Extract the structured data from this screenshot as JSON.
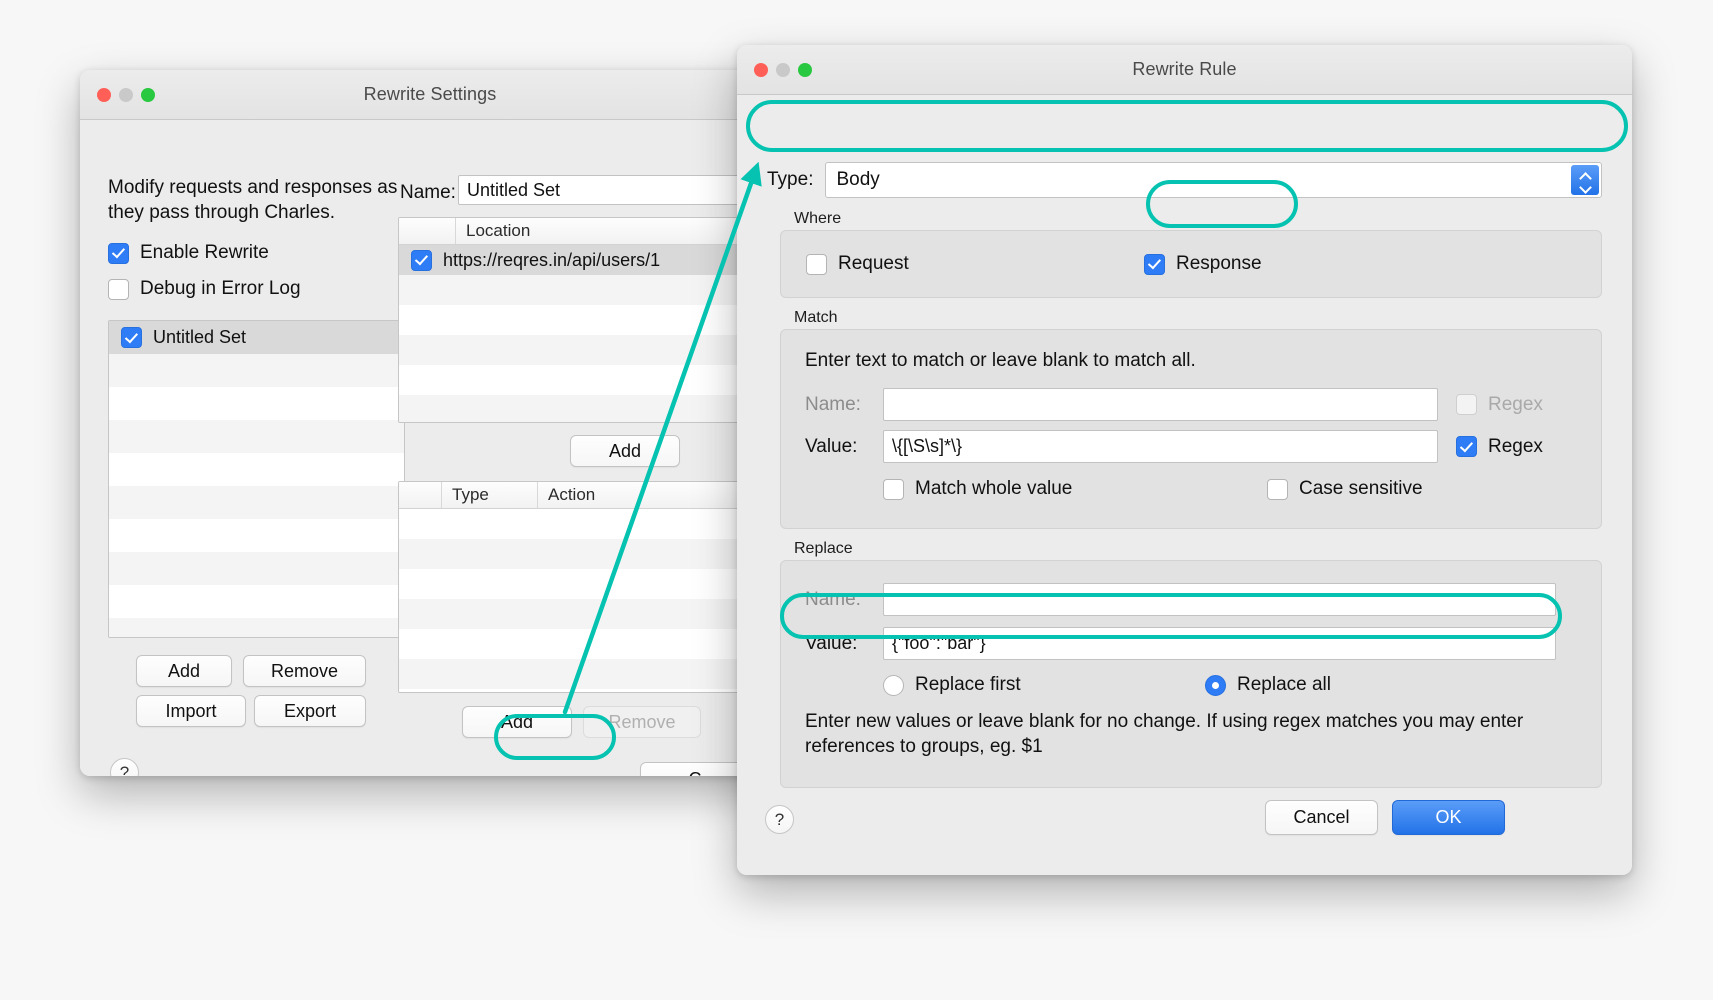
{
  "settings_window": {
    "title": "Rewrite Settings",
    "traffic_lights": [
      "close",
      "minimize",
      "zoom"
    ],
    "blurb": "Modify requests and responses as they pass through Charles.",
    "checkboxes": [
      {
        "label": "Enable Rewrite",
        "checked": true
      },
      {
        "label": "Debug in Error Log",
        "checked": false
      }
    ],
    "set_list": {
      "rows": [
        {
          "label": "Untitled Set",
          "checked": true,
          "selected": true
        }
      ]
    },
    "set_buttons": [
      {
        "label": "Add"
      },
      {
        "label": "Remove"
      },
      {
        "label": "Import"
      },
      {
        "label": "Export"
      }
    ],
    "help_label": "?",
    "name_label": "Name:",
    "name_value": "Untitled Set",
    "location_table": {
      "columns": [
        "Location"
      ],
      "rows": [
        {
          "checked": true,
          "location": "https://reqres.in/api/users/1"
        }
      ]
    },
    "location_add_label": "Add",
    "action_table": {
      "columns": [
        "Type",
        "Action"
      ],
      "rows": []
    },
    "action_buttons": [
      {
        "label": "Add",
        "enabled": true
      },
      {
        "label": "Remove",
        "enabled": false
      }
    ],
    "close_label": "C"
  },
  "rule_window": {
    "title": "Rewrite Rule",
    "type_label": "Type:",
    "type_value": "Body",
    "stepper_icon": "chevron-up-down-icon",
    "where": {
      "title": "Where",
      "request": {
        "label": "Request",
        "checked": false
      },
      "response": {
        "label": "Response",
        "checked": true
      }
    },
    "match": {
      "title": "Match",
      "hint": "Enter text to match or leave blank to match all.",
      "name_label": "Name:",
      "name_value": "",
      "name_regex": {
        "label": "Regex",
        "checked": false,
        "enabled": false
      },
      "value_label": "Value:",
      "value_value": "\\{[\\S\\s]*\\}",
      "value_regex": {
        "label": "Regex",
        "checked": true,
        "enabled": true
      },
      "match_whole": {
        "label": "Match whole value",
        "checked": false
      },
      "case_sensitive": {
        "label": "Case sensitive",
        "checked": false
      }
    },
    "replace": {
      "title": "Replace",
      "name_label": "Name:",
      "name_value": "",
      "value_label": "Value:",
      "value_value": "{\"foo\":\"bar\"}",
      "replace_first": {
        "label": "Replace first",
        "selected": false
      },
      "replace_all": {
        "label": "Replace all",
        "selected": true
      },
      "hint": "Enter new values or leave blank for no change. If using regex matches you may enter references to groups, eg. $1"
    },
    "help_label": "?",
    "cancel_label": "Cancel",
    "ok_label": "OK"
  },
  "annotations": {
    "accent_color": "#05C3B0",
    "highlights": [
      "type-field",
      "response-checkbox",
      "replace-value-field",
      "action-add-button"
    ],
    "arrow": {
      "from": "action-add-button",
      "to": "type-field"
    }
  }
}
